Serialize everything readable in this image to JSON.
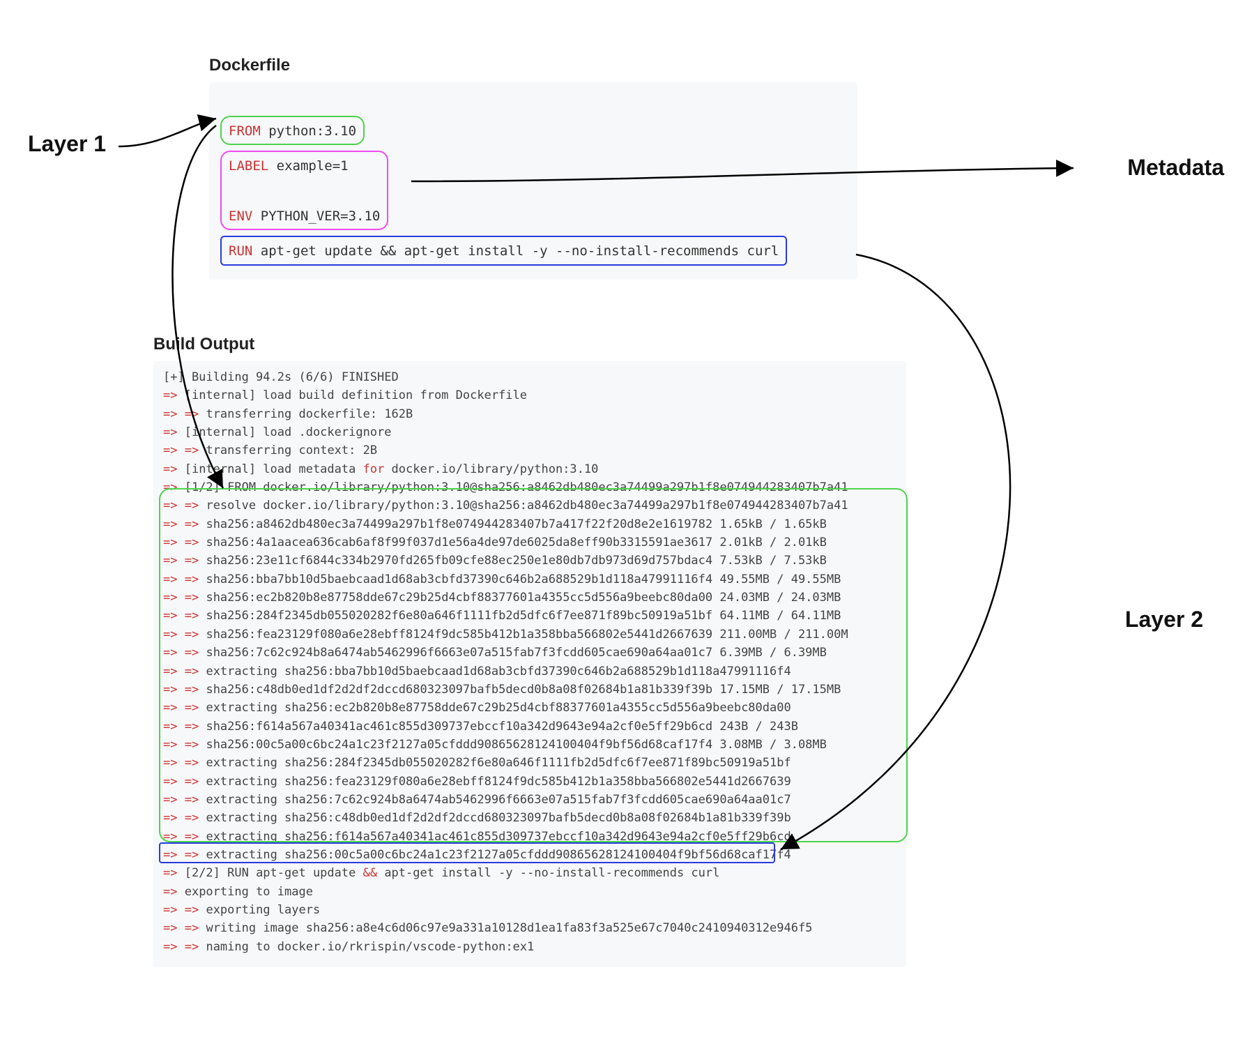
{
  "dockerfile": {
    "title": "Dockerfile",
    "from_kw": "FROM",
    "from_val": " python:3.10",
    "label_kw": "LABEL",
    "label_val": " example=1",
    "env_kw": "ENV",
    "env_val": " PYTHON_VER=3.10",
    "run_kw": "RUN",
    "run_val": " apt-get update && apt-get install -y --no-install-recommends curl"
  },
  "annotations": {
    "layer1": "Layer 1",
    "metadata": "Metadata",
    "layer2": "Layer 2"
  },
  "build": {
    "title": "Build Output",
    "lines": [
      "[+] Building 94.2s (6/6) FINISHED",
      "=> [internal] load build definition from Dockerfile",
      "=> => transferring dockerfile: 162B",
      "=> [internal] load .dockerignore",
      "=> => transferring context: 2B",
      "=> [internal] load metadata for docker.io/library/python:3.10",
      "=> [1/2] FROM docker.io/library/python:3.10@sha256:a8462db480ec3a74499a297b1f8e074944283407b7a41",
      "=> => resolve docker.io/library/python:3.10@sha256:a8462db480ec3a74499a297b1f8e074944283407b7a41",
      "=> => sha256:a8462db480ec3a74499a297b1f8e074944283407b7a417f22f20d8e2e1619782 1.65kB / 1.65kB",
      "=> => sha256:4a1aacea636cab6af8f99f037d1e56a4de97de6025da8eff90b3315591ae3617 2.01kB / 2.01kB",
      "=> => sha256:23e11cf6844c334b2970fd265fb09cfe88ec250e1e80db7db973d69d757bdac4 7.53kB / 7.53kB",
      "=> => sha256:bba7bb10d5baebcaad1d68ab3cbfd37390c646b2a688529b1d118a47991116f4 49.55MB / 49.55MB",
      "=> => sha256:ec2b820b8e87758dde67c29b25d4cbf88377601a4355cc5d556a9beebc80da00 24.03MB / 24.03MB",
      "=> => sha256:284f2345db055020282f6e80a646f1111fb2d5dfc6f7ee871f89bc50919a51bf 64.11MB / 64.11MB",
      "=> => sha256:fea23129f080a6e28ebff8124f9dc585b412b1a358bba566802e5441d2667639 211.00MB / 211.00M",
      "=> => sha256:7c62c924b8a6474ab5462996f6663e07a515fab7f3fcdd605cae690a64aa01c7 6.39MB / 6.39MB",
      "=> => extracting sha256:bba7bb10d5baebcaad1d68ab3cbfd37390c646b2a688529b1d118a47991116f4",
      "=> => sha256:c48db0ed1df2d2df2dccd680323097bafb5decd0b8a08f02684b1a81b339f39b 17.15MB / 17.15MB",
      "=> => extracting sha256:ec2b820b8e87758dde67c29b25d4cbf88377601a4355cc5d556a9beebc80da00",
      "=> => sha256:f614a567a40341ac461c855d309737ebccf10a342d9643e94a2cf0e5ff29b6cd 243B / 243B",
      "=> => sha256:00c5a00c6bc24a1c23f2127a05cfddd90865628124100404f9bf56d68caf17f4 3.08MB / 3.08MB",
      "=> => extracting sha256:284f2345db055020282f6e80a646f1111fb2d5dfc6f7ee871f89bc50919a51bf",
      "=> => extracting sha256:fea23129f080a6e28ebff8124f9dc585b412b1a358bba566802e5441d2667639",
      "=> => extracting sha256:7c62c924b8a6474ab5462996f6663e07a515fab7f3fcdd605cae690a64aa01c7",
      "=> => extracting sha256:c48db0ed1df2d2df2dccd680323097bafb5decd0b8a08f02684b1a81b339f39b",
      "=> => extracting sha256:f614a567a40341ac461c855d309737ebccf10a342d9643e94a2cf0e5ff29b6cd",
      "=> => extracting sha256:00c5a00c6bc24a1c23f2127a05cfddd90865628124100404f9bf56d68caf17f4",
      "=> [2/2] RUN apt-get update && apt-get install -y --no-install-recommends curl",
      "=> exporting to image",
      "=> => exporting layers",
      "=> => writing image sha256:a8e4c6d06c97e9a331a10128d1ea1fa83f3a525e67c7040c2410940312e946f5",
      "=> => naming to docker.io/rkrispin/vscode-python:ex1"
    ],
    "hl_for": "for",
    "hl_amp": "&&"
  }
}
